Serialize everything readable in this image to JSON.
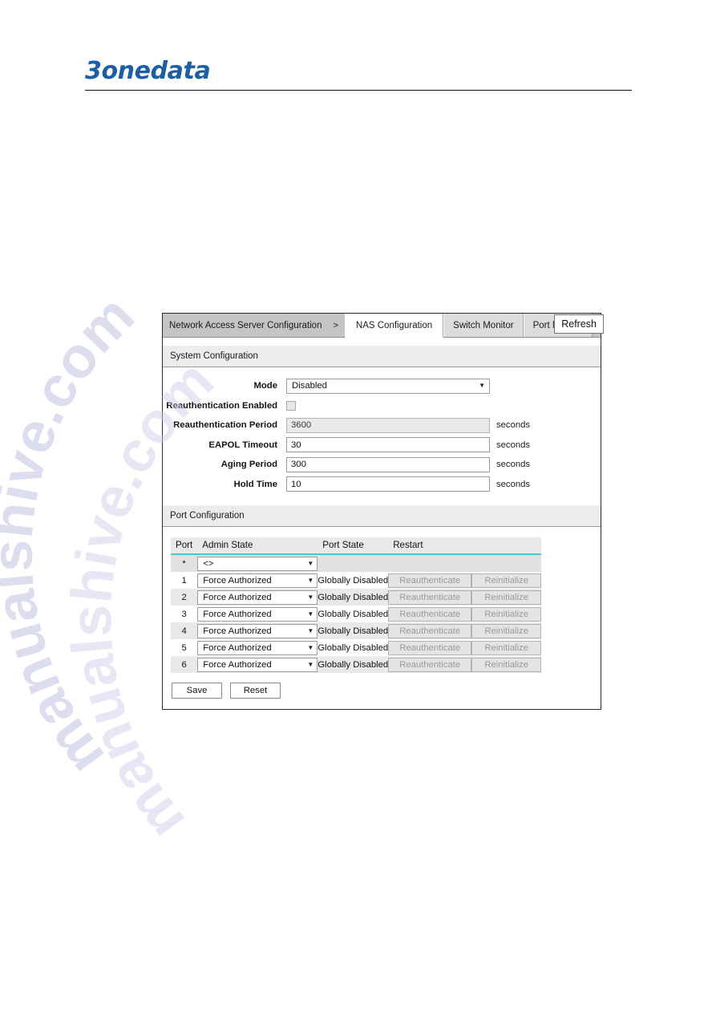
{
  "brand": {
    "logo_text": "3onedata"
  },
  "panel": {
    "breadcrumb": "Network Access Server Configuration",
    "breadcrumb_arrow": ">",
    "tabs": [
      {
        "label": "NAS Configuration",
        "active": true
      },
      {
        "label": "Switch Monitor",
        "active": false
      },
      {
        "label": "Port Monitor",
        "active": false
      }
    ],
    "refresh_label": "Refresh"
  },
  "system_configuration": {
    "section_title": "System Configuration",
    "rows": [
      {
        "label": "Mode",
        "type": "select",
        "value": "Disabled",
        "unit": ""
      },
      {
        "label": "Reauthentication Enabled",
        "type": "checkbox",
        "value": "",
        "checked": false,
        "unit": ""
      },
      {
        "label": "Reauthentication Period",
        "type": "text",
        "value": "3600",
        "disabled": true,
        "unit": "seconds"
      },
      {
        "label": "EAPOL Timeout",
        "type": "text",
        "value": "30",
        "disabled": false,
        "unit": "seconds"
      },
      {
        "label": "Aging Period",
        "type": "text",
        "value": "300",
        "disabled": false,
        "unit": "seconds"
      },
      {
        "label": "Hold Time",
        "type": "text",
        "value": "10",
        "disabled": false,
        "unit": "seconds"
      }
    ]
  },
  "port_configuration": {
    "section_title": "Port Configuration",
    "columns": [
      "Port",
      "Admin State",
      "Port State",
      "Restart"
    ],
    "star_row": {
      "port": "*",
      "admin_state": "<>"
    },
    "rows": [
      {
        "port": "1",
        "admin_state": "Force Authorized",
        "port_state": "Globally Disabled",
        "reauthenticate": "Reauthenticate",
        "reinitialize": "Reinitialize"
      },
      {
        "port": "2",
        "admin_state": "Force Authorized",
        "port_state": "Globally Disabled",
        "reauthenticate": "Reauthenticate",
        "reinitialize": "Reinitialize"
      },
      {
        "port": "3",
        "admin_state": "Force Authorized",
        "port_state": "Globally Disabled",
        "reauthenticate": "Reauthenticate",
        "reinitialize": "Reinitialize"
      },
      {
        "port": "4",
        "admin_state": "Force Authorized",
        "port_state": "Globally Disabled",
        "reauthenticate": "Reauthenticate",
        "reinitialize": "Reinitialize"
      },
      {
        "port": "5",
        "admin_state": "Force Authorized",
        "port_state": "Globally Disabled",
        "reauthenticate": "Reauthenticate",
        "reinitialize": "Reinitialize"
      },
      {
        "port": "6",
        "admin_state": "Force Authorized",
        "port_state": "Globally Disabled",
        "reauthenticate": "Reauthenticate",
        "reinitialize": "Reinitialize"
      }
    ]
  },
  "actions": {
    "save_label": "Save",
    "reset_label": "Reset"
  },
  "watermark": {
    "text": "manualshive.com",
    "color": "#c9c9e8"
  }
}
